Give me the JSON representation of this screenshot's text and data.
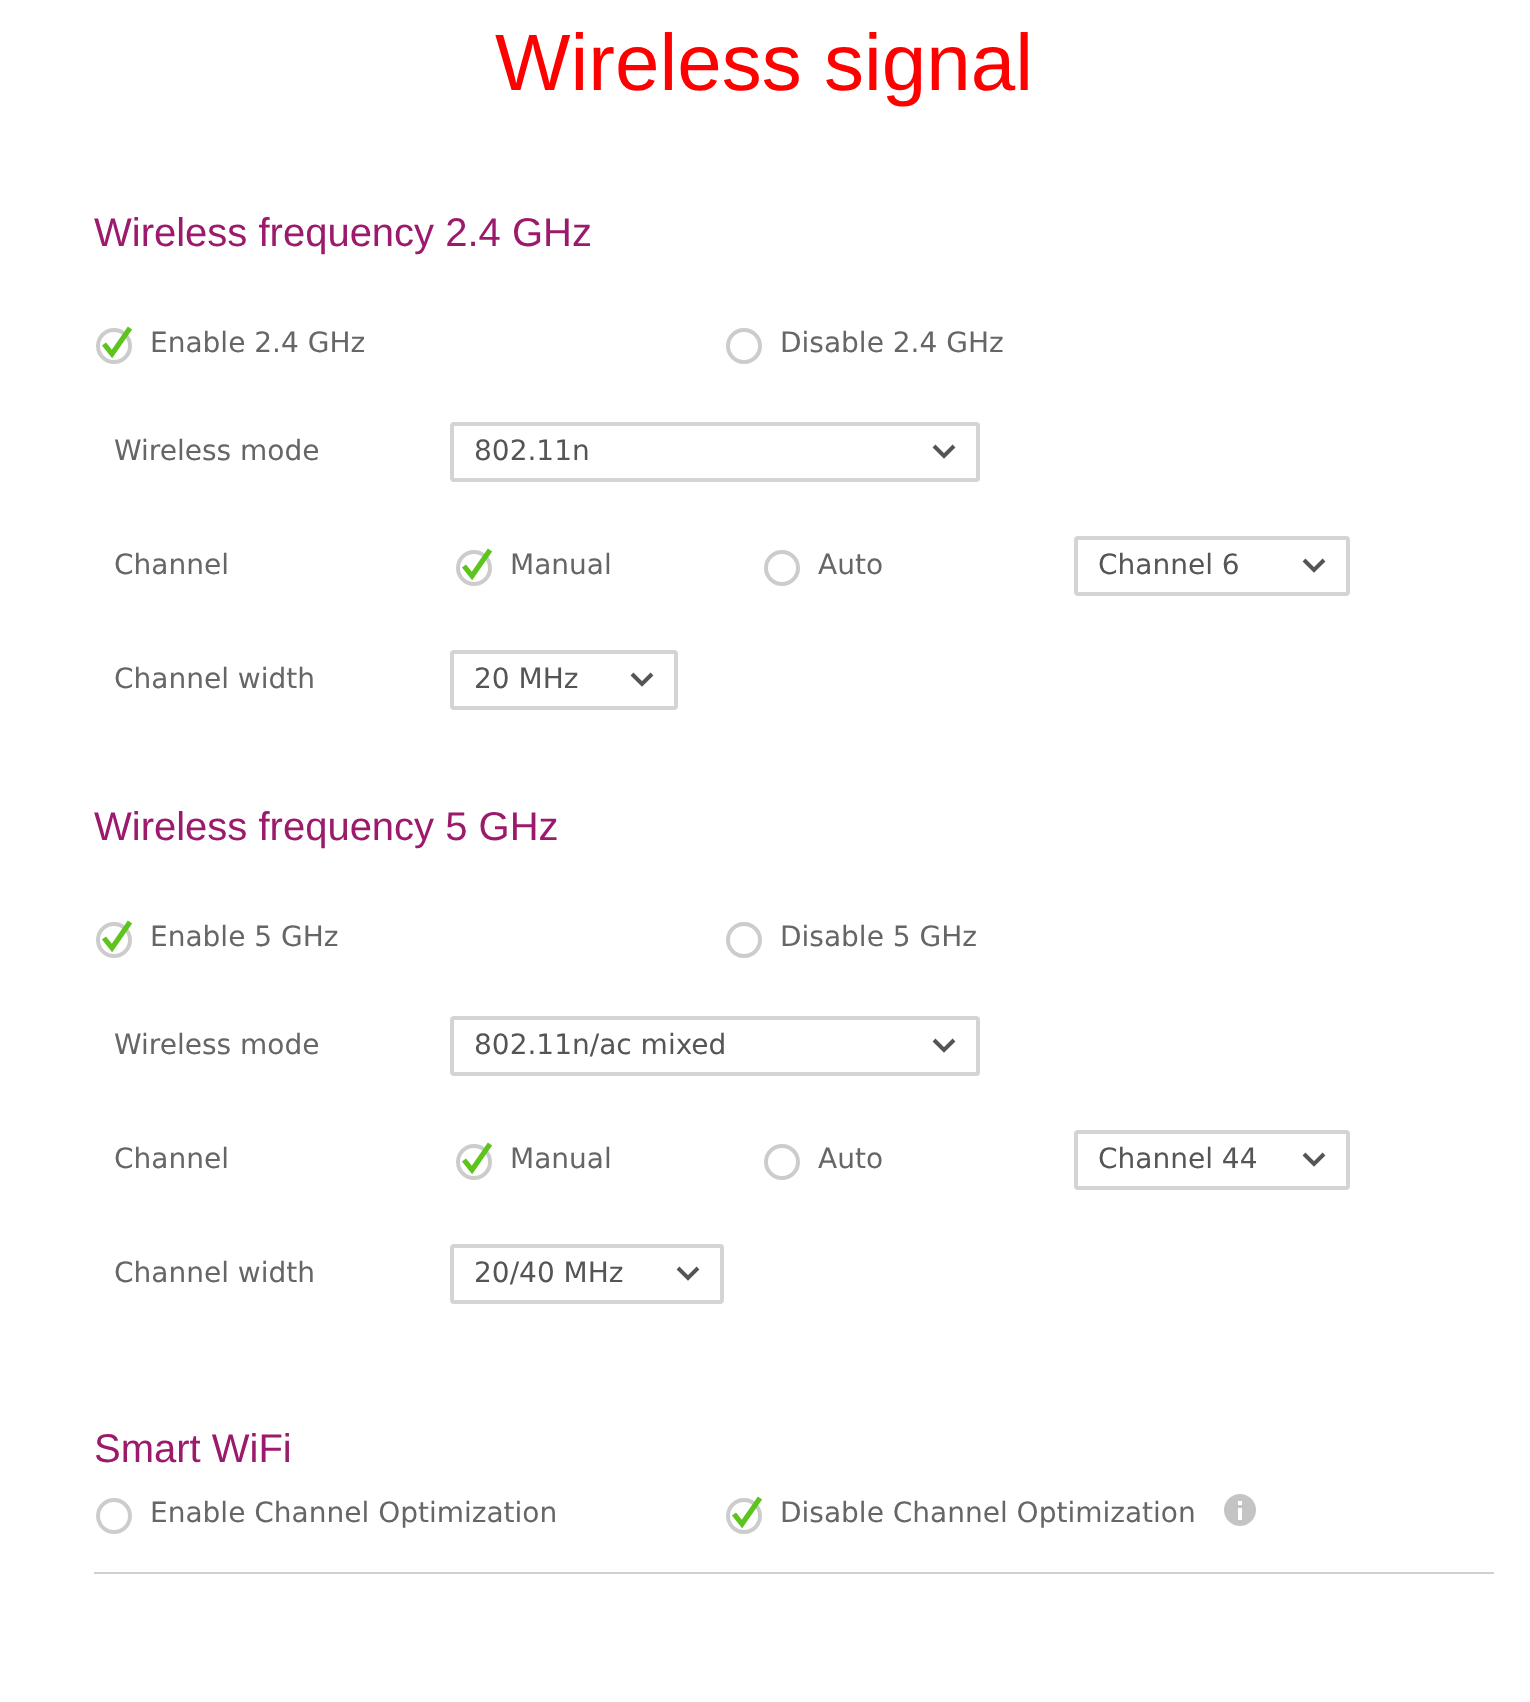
{
  "title": "Wireless signal",
  "sections": [
    {
      "heading": "Wireless frequency 2.4 GHz",
      "options": [
        {
          "label": "Enable 2.4 GHz",
          "selected": true
        },
        {
          "label": "Disable 2.4 GHz",
          "selected": false
        }
      ],
      "rows": [
        {
          "kind": "select",
          "label": "Wireless mode",
          "value": "802.11n"
        },
        {
          "kind": "channel",
          "label": "Channel",
          "options": [
            {
              "label": "Manual",
              "selected": true
            },
            {
              "label": "Auto",
              "selected": false
            }
          ],
          "value": "Channel 6"
        },
        {
          "kind": "select",
          "label": "Channel width",
          "value": "20 MHz"
        }
      ]
    },
    {
      "heading": "Wireless frequency 5 GHz",
      "options": [
        {
          "label": "Enable 5 GHz",
          "selected": true
        },
        {
          "label": "Disable 5 GHz",
          "selected": false
        }
      ],
      "rows": [
        {
          "kind": "select",
          "label": "Wireless mode",
          "value": "802.11n/ac mixed"
        },
        {
          "kind": "channel",
          "label": "Channel",
          "options": [
            {
              "label": "Manual",
              "selected": true
            },
            {
              "label": "Auto",
              "selected": false
            }
          ],
          "value": "Channel 44"
        },
        {
          "kind": "select",
          "label": "Channel width",
          "value": "20/40 MHz"
        }
      ]
    }
  ],
  "smart": {
    "heading": "Smart WiFi",
    "options": [
      {
        "label": "Enable Channel Optimization",
        "selected": false
      },
      {
        "label": "Disable Channel Optimization",
        "selected": true
      }
    ]
  }
}
